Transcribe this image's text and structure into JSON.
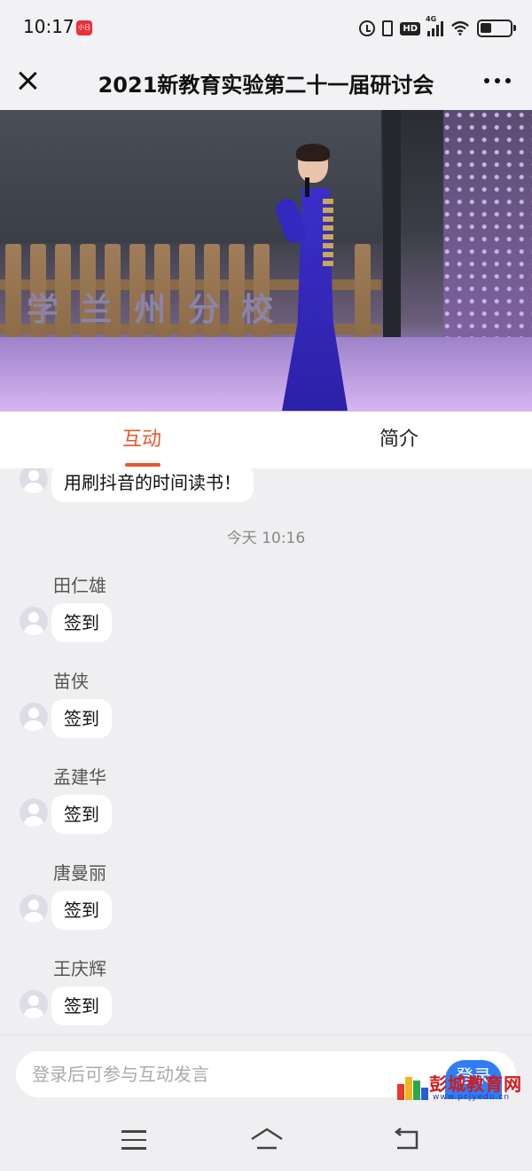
{
  "status_bar": {
    "time": "10:17",
    "app_icon_text": "小日历",
    "network": "4G"
  },
  "header": {
    "title": "2021新教育实验第二十一届研讨会"
  },
  "video": {
    "banner_text": "学 兰 州 分 校"
  },
  "tabs": [
    {
      "label": "互动",
      "active": true,
      "color": "#e8572c"
    },
    {
      "label": "简介",
      "active": false
    }
  ],
  "chat": {
    "partial_message": "用刷抖音的时间读书！",
    "timestamp": "今天 10:16",
    "messages": [
      {
        "sender": "田仁雄",
        "text": "签到"
      },
      {
        "sender": "苗侠",
        "text": "签到"
      },
      {
        "sender": "孟建华",
        "text": "签到"
      },
      {
        "sender": "唐曼丽",
        "text": "签到"
      },
      {
        "sender": "王庆辉",
        "text": "签到"
      }
    ]
  },
  "input_bar": {
    "placeholder": "登录后可参与互动发言",
    "login_label": "登录",
    "login_color": "#2f7cf6"
  },
  "watermark": {
    "title": "彭城教育网",
    "url": "www.pcjyedu.cn"
  }
}
